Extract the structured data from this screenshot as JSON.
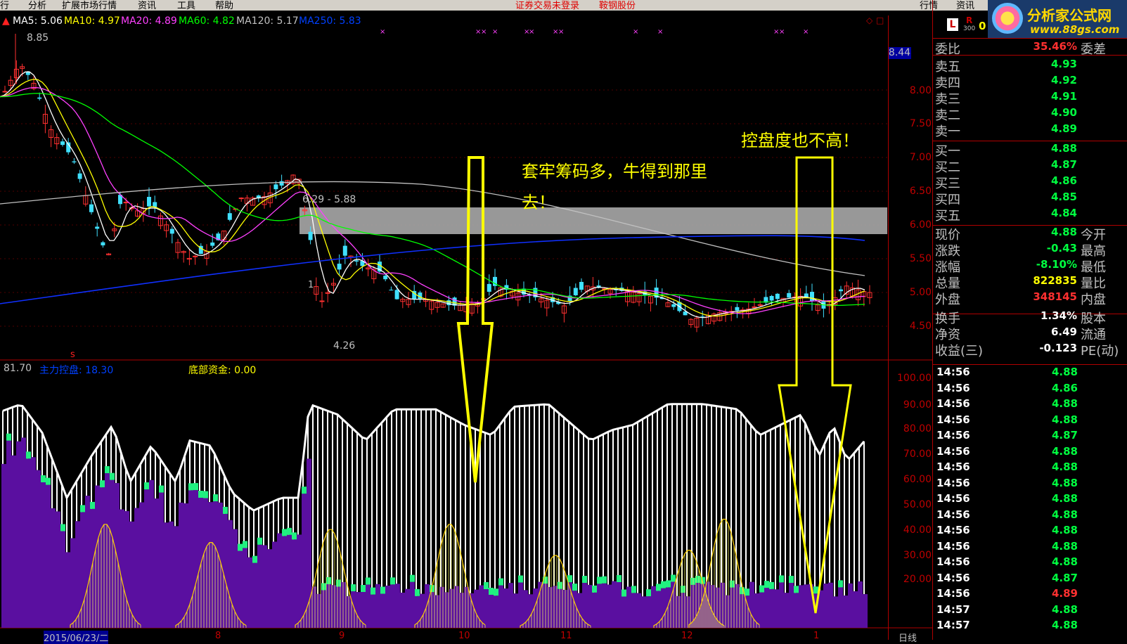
{
  "menu": {
    "items": [
      "行",
      "分析",
      "扩展市场行情",
      "资讯",
      "工具",
      "帮助"
    ],
    "warn1": "证券交易未登录",
    "warn2": "鞍钢股份",
    "right1": "行情",
    "right2": "资讯"
  },
  "logo": {
    "name": "分析家公式网",
    "url": "www.88gs.com"
  },
  "badge": {
    "l": "L",
    "r": "R",
    "num": "300",
    "zero": "0"
  },
  "ma": {
    "ma5": "MA5: 5.06",
    "ma10": "MA10: 4.97",
    "ma20": "MA20: 4.89",
    "ma60": "MA60: 4.82",
    "ma120": "MA120: 5.17",
    "ma250": "MA250: 5.83"
  },
  "ma_colors": {
    "ma5": "#ffffff",
    "ma10": "#ffff00",
    "ma20": "#ff40ff",
    "ma60": "#00ff00",
    "ma120": "#c0c0c0",
    "ma250": "#0030ff"
  },
  "price_labels": {
    "high": "8.85",
    "low": "4.26",
    "range": "6.29 - 5.88",
    "cur": "8.44",
    "marker": "1"
  },
  "price_axis": [
    "8.00",
    "7.50",
    "7.00",
    "6.50",
    "6.00",
    "5.50",
    "5.00",
    "4.50"
  ],
  "sub_header": {
    "value": "81.70",
    "main_label": "主力控盘: 18.30",
    "bottom_label": "底部资金: 0.00",
    "s_mark": "s"
  },
  "sub_axis": [
    "100.00",
    "90.00",
    "80.00",
    "70.00",
    "60.00",
    "50.00",
    "40.00",
    "30.00",
    "20.00"
  ],
  "date_axis": {
    "first": "2015/06/23/二",
    "ticks": [
      "8",
      "9",
      "10",
      "11",
      "12",
      "1"
    ],
    "right": "日线"
  },
  "annotations": {
    "note1_line1": "套牢筹码多，牛得到那里",
    "note1_line2": "去！",
    "note2": "控盘度也不高！"
  },
  "quote": {
    "weibi": {
      "label": "委比",
      "value": "35.46%",
      "label2": "委差"
    },
    "sells": [
      {
        "label": "卖五",
        "price": "4.93"
      },
      {
        "label": "卖四",
        "price": "4.92"
      },
      {
        "label": "卖三",
        "price": "4.91"
      },
      {
        "label": "卖二",
        "price": "4.90"
      },
      {
        "label": "卖一",
        "price": "4.89"
      }
    ],
    "buys": [
      {
        "label": "买一",
        "price": "4.88"
      },
      {
        "label": "买二",
        "price": "4.87"
      },
      {
        "label": "买三",
        "price": "4.86"
      },
      {
        "label": "买四",
        "price": "4.85"
      },
      {
        "label": "买五",
        "price": "4.84"
      }
    ],
    "info": [
      {
        "label": "现价",
        "value": "4.88",
        "label2": "今开",
        "color": "#00ff40"
      },
      {
        "label": "涨跌",
        "value": "-0.43",
        "label2": "最高",
        "color": "#00ff40"
      },
      {
        "label": "涨幅",
        "value": "-8.10%",
        "label2": "最低",
        "color": "#00ff40"
      },
      {
        "label": "总量",
        "value": "822835",
        "label2": "量比",
        "color": "#ffff00"
      },
      {
        "label": "外盘",
        "value": "348145",
        "label2": "内盘",
        "color": "#ff3030"
      }
    ],
    "info2": [
      {
        "label": "换手",
        "value": "1.34%",
        "label2": "股本"
      },
      {
        "label": "净资",
        "value": "6.49",
        "label2": "流通"
      },
      {
        "label": "收益(三)",
        "value": "-0.123",
        "label2": "PE(动)"
      }
    ],
    "ticks": [
      {
        "time": "14:56",
        "price": "4.88"
      },
      {
        "time": "14:56",
        "price": "4.86"
      },
      {
        "time": "14:56",
        "price": "4.88"
      },
      {
        "time": "14:56",
        "price": "4.88"
      },
      {
        "time": "14:56",
        "price": "4.87"
      },
      {
        "time": "14:56",
        "price": "4.88"
      },
      {
        "time": "14:56",
        "price": "4.88"
      },
      {
        "time": "14:56",
        "price": "4.88"
      },
      {
        "time": "14:56",
        "price": "4.88"
      },
      {
        "time": "14:56",
        "price": "4.88"
      },
      {
        "time": "14:56",
        "price": "4.88"
      },
      {
        "time": "14:56",
        "price": "4.88"
      },
      {
        "time": "14:56",
        "price": "4.88"
      },
      {
        "time": "14:56",
        "price": "4.87"
      },
      {
        "time": "14:56",
        "price": "4.89"
      },
      {
        "time": "14:57",
        "price": "4.88"
      },
      {
        "time": "14:57",
        "price": "4.88"
      }
    ]
  }
}
